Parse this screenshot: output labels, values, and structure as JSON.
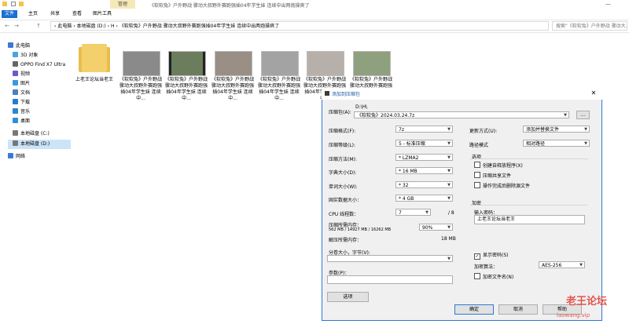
{
  "window": {
    "title": "《软软兔》户外野战 骤动大叔野外赛跑强插04年学生妹 连续中出两炮操爽了"
  },
  "ribbon": {
    "tabs": [
      "文件",
      "主页",
      "共享",
      "查看",
      "图片工具"
    ],
    "manage": "管理"
  },
  "address": {
    "nav_back": "←",
    "nav_forward": "→",
    "nav_up": "↑",
    "path": "› 此电脑 › 本地磁盘 (D:) › H › 《软软兔》户外野战 骤动大叔野外赛跑强插04年学生妹 连续中出两炮操爽了",
    "search_placeholder": "搜索\"《软软兔》户外野战 骤动大..."
  },
  "sidebar": {
    "items": [
      {
        "label": "此电脑",
        "color": "#3a7bd5"
      },
      {
        "label": "3D 对象",
        "color": "#4aa3df"
      },
      {
        "label": "OPPO Find X7 Ultra",
        "color": "#666666"
      },
      {
        "label": "视频",
        "color": "#6a5acd"
      },
      {
        "label": "图片",
        "color": "#3a9ad9"
      },
      {
        "label": "文档",
        "color": "#4a7fc0"
      },
      {
        "label": "下载",
        "color": "#2a7bd0"
      },
      {
        "label": "音乐",
        "color": "#2a88c8"
      },
      {
        "label": "桌面",
        "color": "#2f8fd8"
      },
      {
        "label": "本地磁盘 (C:)",
        "color": "#777777"
      },
      {
        "label": "本地磁盘 (D:)",
        "color": "#777777"
      },
      {
        "label": "网络",
        "color": "#3a7bd5"
      }
    ]
  },
  "files": [
    {
      "caption": "上老王论坛当老王",
      "kind": "folder"
    },
    {
      "caption": "《软软兔》户外野战 骤动大叔野外赛跑强插04年学生妹 连续中...",
      "kind": "image"
    },
    {
      "caption": "《软软兔》户外野战 骤动大叔野外赛跑强插04年学生妹 连续中...",
      "kind": "video"
    },
    {
      "caption": "《软软兔》户外野战 骤动大叔野外赛跑强插04年学生妹 连续中...",
      "kind": "image"
    },
    {
      "caption": "《软软兔》户外野战 骤动大叔野外赛跑强插04年学生妹 连续中...",
      "kind": "image"
    },
    {
      "caption": "《软软兔》户外野战 骤动大叔野外赛跑强插04年学生妹 连续中...",
      "kind": "image"
    },
    {
      "caption": "《软软兔》户外野战 骤动大叔野外赛跑强插04年学生妹 连续中...",
      "kind": "image"
    }
  ],
  "dialog": {
    "title": "添加到压缩包",
    "close": "✕",
    "archive_label": "压缩包(A):",
    "archive_dir": "D:\\H\\",
    "archive_name": "《软软兔》2024.03.24.7z",
    "browse": "...",
    "format_label": "压缩格式(F):",
    "format_value": "7z",
    "level_label": "压缩等级(L):",
    "level_value": "5 - 标准压缩",
    "method_label": "压缩方法(M):",
    "method_value": "* LZMA2",
    "dict_label": "字典大小(D):",
    "dict_value": "* 16 MB",
    "word_label": "单词大小(W):",
    "word_value": "* 32",
    "solid_label": "固实数据大小：",
    "solid_value": "* 4 GB",
    "cpu_label": "CPU 线程数：",
    "cpu_value": "7",
    "cpu_total": "/ 8",
    "mem_label": "压缩所需内存：",
    "mem_detail": "562 MB / 14927 MB / 16262 MB",
    "mem_value": "90%",
    "decomp_label": "解压所需内存：",
    "decomp_value": "18 MB",
    "split_label": "分卷大小，字节(V):",
    "params_label": "参数(P)：",
    "options_button": "选项",
    "update_label": "更新方式(U):",
    "update_value": "添加并替换文件",
    "path_label": "路径模式",
    "path_value": "相对路径",
    "opts_title": "选项",
    "opt1": "创建自释放程序(X)",
    "opt2": "压缩共享文件",
    "opt3": "操作完成后删除源文件",
    "enc_title": "加密",
    "pwd_label": "输入密码：",
    "pwd_value": "上老王论坛当老王",
    "show_pwd": "显示密码(S)",
    "enc_method_label": "加密算法：",
    "enc_method_value": "AES-256",
    "enc_names": "加密文件名(N)",
    "ok": "确定",
    "cancel": "取消",
    "help": "帮助"
  },
  "watermark": {
    "line1": "老王论坛",
    "line2": "laowang.vip"
  }
}
